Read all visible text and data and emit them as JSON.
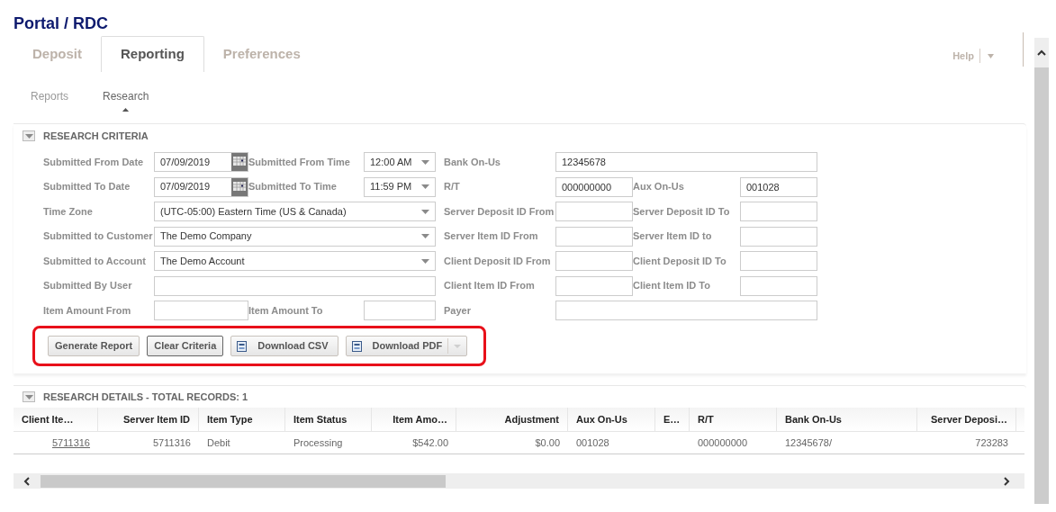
{
  "title": "Portal / RDC",
  "tabs": [
    {
      "label": "Deposit",
      "selected": false
    },
    {
      "label": "Reporting",
      "selected": true
    },
    {
      "label": "Preferences",
      "selected": false
    }
  ],
  "help": {
    "label": "Help"
  },
  "subtabs": [
    {
      "label": "Reports",
      "selected": false
    },
    {
      "label": "Research",
      "selected": true
    }
  ],
  "criteria": {
    "title": "RESEARCH CRITERIA",
    "expanded": true,
    "left_rows": [
      [
        {
          "kind": "label",
          "text": "Submitted From Date"
        },
        {
          "kind": "date",
          "value": "07/09/2019"
        },
        {
          "kind": "label",
          "text": "Submitted From Time"
        },
        {
          "kind": "select",
          "value": "12:00 AM"
        }
      ],
      [
        {
          "kind": "label",
          "text": "Submitted To Date"
        },
        {
          "kind": "date",
          "value": "07/09/2019"
        },
        {
          "kind": "label",
          "text": "Submitted To Time"
        },
        {
          "kind": "select",
          "value": "11:59 PM"
        }
      ],
      [
        {
          "kind": "label",
          "text": "Time Zone"
        },
        {
          "kind": "select",
          "value": "(UTC-05:00) Eastern Time (US & Canada)"
        }
      ],
      [
        {
          "kind": "label",
          "text": "Submitted to Customer"
        },
        {
          "kind": "select",
          "value": "The Demo Company"
        }
      ],
      [
        {
          "kind": "label",
          "text": "Submitted to Account"
        },
        {
          "kind": "select",
          "value": "The Demo Account"
        }
      ],
      [
        {
          "kind": "label",
          "text": "Submitted By User"
        },
        {
          "kind": "text"
        }
      ],
      [
        {
          "kind": "label",
          "text": "Item Amount From"
        },
        {
          "kind": "text"
        },
        {
          "kind": "label",
          "text": "Item Amount To"
        },
        {
          "kind": "text"
        }
      ]
    ],
    "right_rows": [
      [
        {
          "kind": "label",
          "text": "Bank On-Us"
        },
        {
          "kind": "text",
          "value": "12345678"
        }
      ],
      [
        {
          "kind": "label",
          "text": "R/T"
        },
        {
          "kind": "text",
          "value": "000000000"
        },
        {
          "kind": "label",
          "text": "Aux On-Us"
        },
        {
          "kind": "text",
          "value": "001028"
        }
      ],
      [
        {
          "kind": "label",
          "text": "Server Deposit ID From"
        },
        {
          "kind": "text"
        },
        {
          "kind": "label",
          "text": "Server Deposit ID To"
        },
        {
          "kind": "text"
        }
      ],
      [
        {
          "kind": "label",
          "text": "Server Item ID From"
        },
        {
          "kind": "text"
        },
        {
          "kind": "label",
          "text": "Server Item ID to"
        },
        {
          "kind": "text"
        }
      ],
      [
        {
          "kind": "label",
          "text": "Client Deposit ID From"
        },
        {
          "kind": "text"
        },
        {
          "kind": "label",
          "text": "Client Deposit ID To"
        },
        {
          "kind": "text"
        }
      ],
      [
        {
          "kind": "label",
          "text": "Client Item ID From"
        },
        {
          "kind": "text"
        },
        {
          "kind": "label",
          "text": "Client Item ID To"
        },
        {
          "kind": "text"
        }
      ],
      [
        {
          "kind": "label",
          "text": "Payer"
        },
        {
          "kind": "text"
        }
      ]
    ],
    "buttons": [
      {
        "label": "Generate Report",
        "kind": "plain",
        "focused": false
      },
      {
        "label": "Clear Criteria",
        "kind": "plain",
        "focused": true
      },
      {
        "label": "Download CSV",
        "kind": "icon",
        "focused": false
      },
      {
        "label": "Download PDF",
        "kind": "split",
        "focused": false
      }
    ]
  },
  "details": {
    "title": "RESEARCH DETAILS - TOTAL RECORDS: 1",
    "expanded": true,
    "columns": [
      "Client Ite…",
      "Server Item ID",
      "Item Type",
      "Item Status",
      "Item Amo…",
      "Adjustment",
      "Aux On-Us",
      "E…",
      "R/T",
      "Bank On-Us",
      "Server Deposi…"
    ],
    "rows": [
      [
        "5711316",
        "5711316",
        "Debit",
        "Processing",
        "$542.00",
        "$0.00",
        "001028",
        null,
        "000000000",
        "12345678/",
        "723283"
      ]
    ]
  }
}
